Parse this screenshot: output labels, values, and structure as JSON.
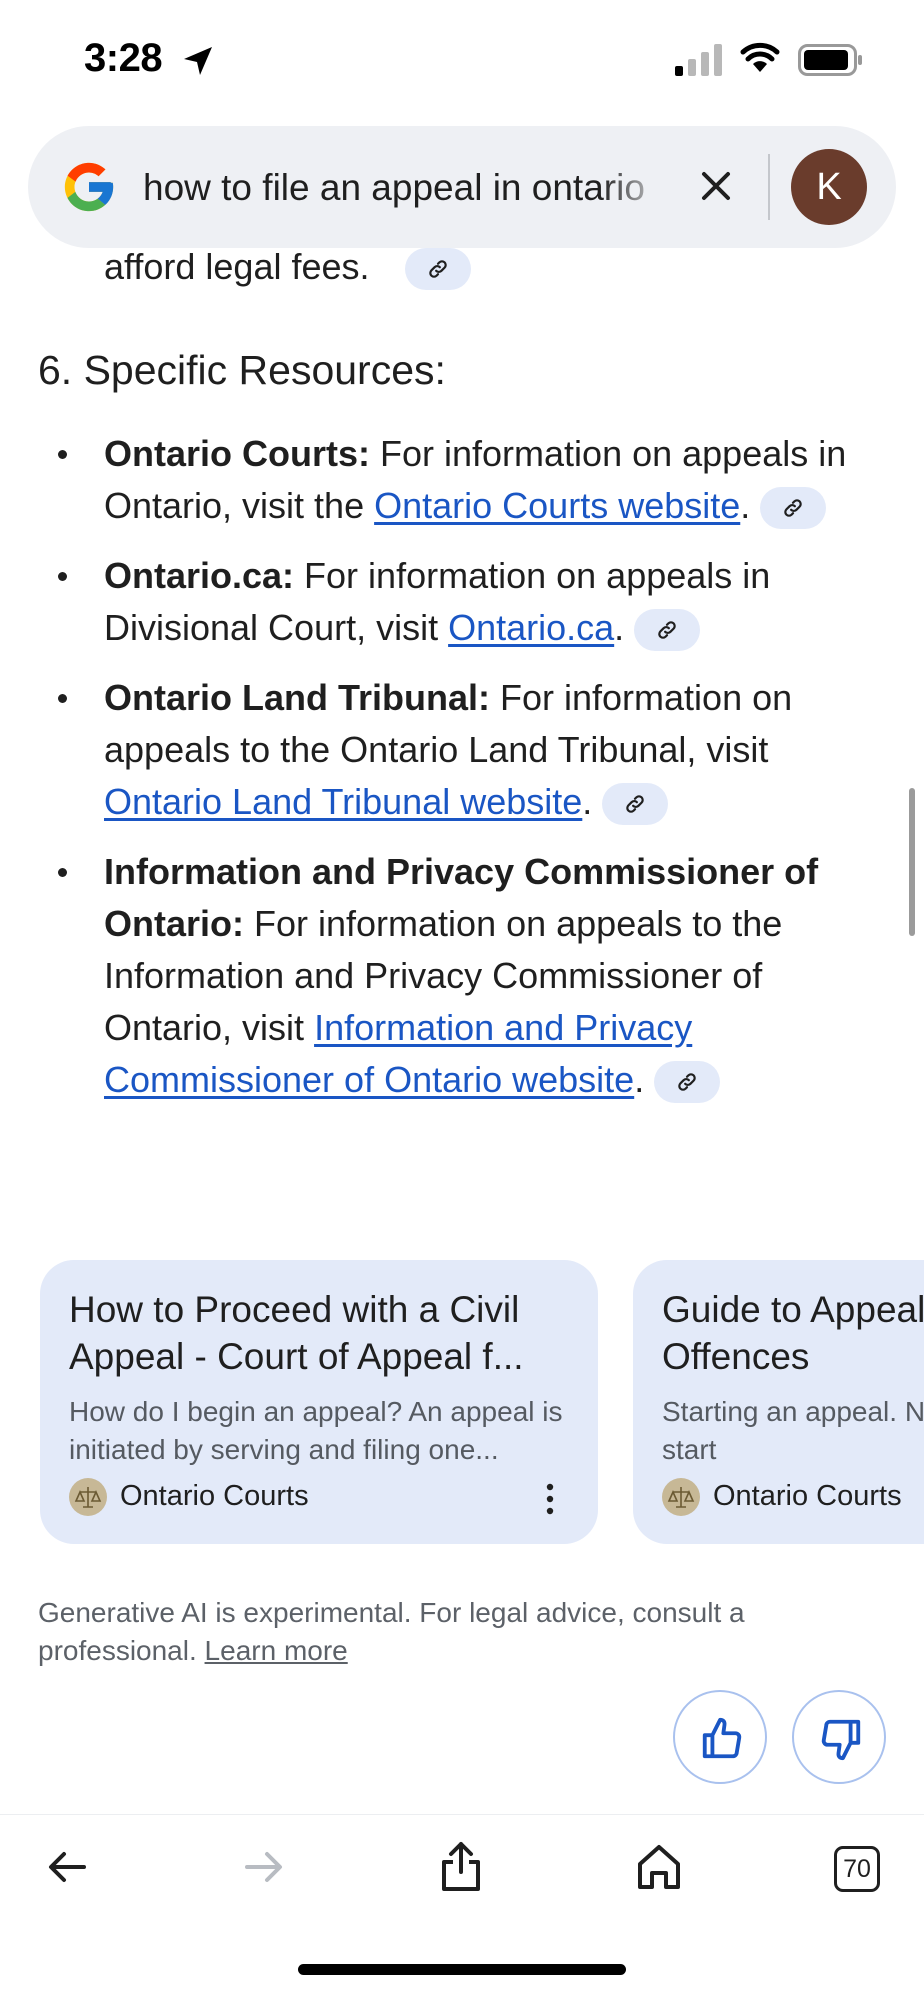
{
  "status_bar": {
    "time": "3:28"
  },
  "search": {
    "query": "how to file an appeal in ontario",
    "avatar_initial": "K"
  },
  "content": {
    "partial_line": "afford legal fees.",
    "heading": "6. Specific Resources:",
    "resources": [
      {
        "bold": "Ontario Courts:",
        "before": " For information on appeals in Ontario, visit the ",
        "link": "Ontario Courts website",
        "after": "."
      },
      {
        "bold": "Ontario.ca:",
        "before": " For information on appeals in Divisional Court, visit ",
        "link": "Ontario.ca",
        "after": "."
      },
      {
        "bold": "Ontario Land Tribunal:",
        "before": " For information on appeals to the Ontario Land Tribunal, visit ",
        "link": "Ontario Land Tribunal website",
        "after": "."
      },
      {
        "bold": "Information and Privacy Commissioner of Ontario:",
        "before": " For information on appeals to the Information and Privacy Commissioner of Ontario, visit ",
        "link": "Information and Privacy Commissioner of Ontario website",
        "after": "."
      }
    ]
  },
  "cards": [
    {
      "title": "How to Proceed with a Civil Appeal - Court of Appeal f...",
      "snippet": "How do I begin an appeal? An appeal is initiated by serving and filing one...",
      "source": "Ontario Courts"
    },
    {
      "title": "Guide to Appeals in Provincial Offences",
      "snippet": "Starting an appeal. N The first step to start",
      "source": "Ontario Courts"
    }
  ],
  "footer": {
    "disclaimer": "Generative AI is experimental. For legal advice, consult a professional.",
    "learn_more": "Learn more"
  },
  "toolbar": {
    "tab_count": "70"
  },
  "colors": {
    "link": "#1a56c4",
    "card_bg": "#e3eaf9",
    "search_bg": "#eef0f4",
    "avatar_bg": "#6a3c2c"
  }
}
